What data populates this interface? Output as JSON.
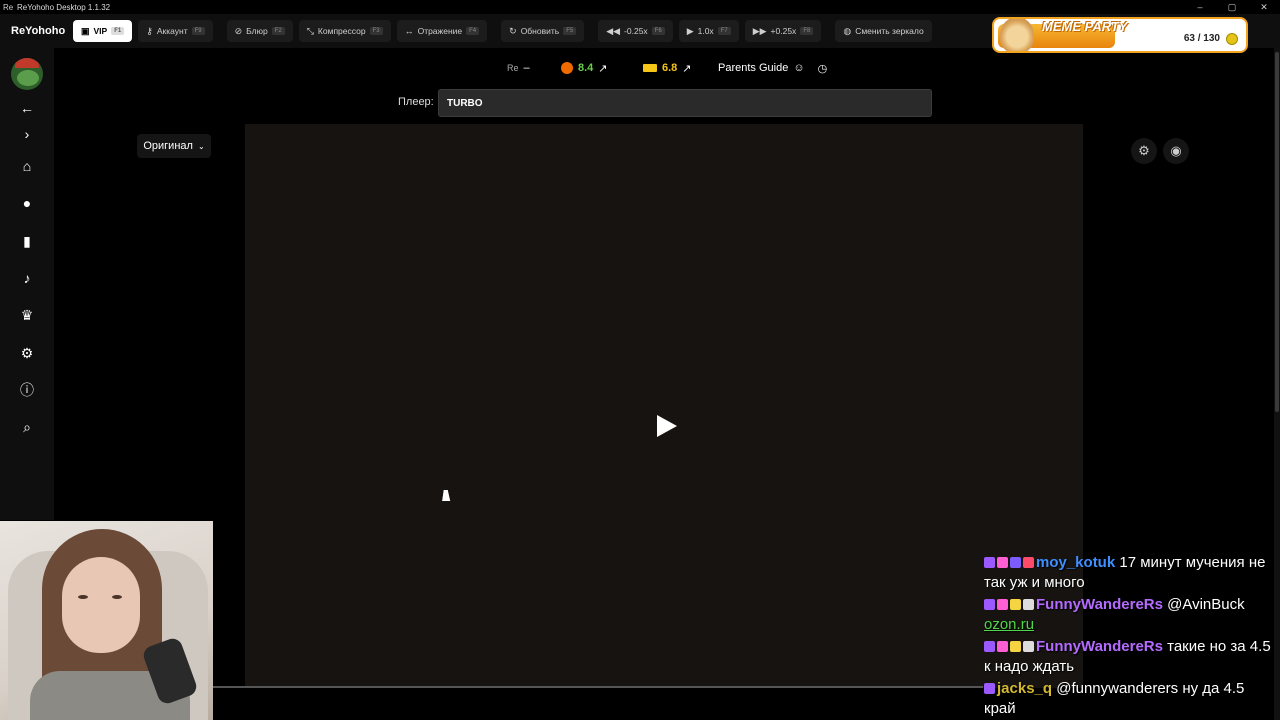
{
  "window": {
    "app_icon": "Re",
    "title": "ReYohoho Desktop 1.1.32",
    "controls": [
      "–",
      "▢",
      "✕"
    ]
  },
  "toolbar": {
    "brand": "ReYohoho",
    "buttons": [
      {
        "label": "VIP",
        "key": "F1",
        "icon": "window-icon"
      },
      {
        "label": "Аккаунт",
        "key": "F9",
        "icon": "key-icon"
      },
      {
        "label": "Блюр",
        "key": "F2",
        "icon": "eye-slash-icon"
      },
      {
        "label": "Компрессор",
        "key": "F3",
        "icon": "compress-icon"
      },
      {
        "label": "Отражение",
        "key": "F4",
        "icon": "mirror-icon"
      },
      {
        "label": "Обновить",
        "key": "F5",
        "icon": "refresh-icon"
      },
      {
        "label": "-0.25x",
        "key": "F6",
        "icon": "rewind-icon"
      },
      {
        "label": "1.0x",
        "key": "F7",
        "icon": "play-icon"
      },
      {
        "label": "+0.25x",
        "key": "F8",
        "icon": "forward-icon"
      },
      {
        "label": "Сменить зеркало",
        "key": "",
        "icon": "globe-icon"
      }
    ]
  },
  "overlay": {
    "title": "MEME PARTY",
    "count": "63 / 130",
    "progress": 0.48
  },
  "info": {
    "re_label": "Re",
    "re_value": "–",
    "kp_rating": "8.4",
    "imdb_rating": "6.8",
    "parents_guide": "Parents Guide"
  },
  "player": {
    "label": "Плеер:",
    "value": "TURBO"
  },
  "original_button": "Оригинал",
  "chat": [
    {
      "user": "moy_kotuk",
      "color": "#3f8fff",
      "text": " 17 минут мучения не так уж и много",
      "badges": [
        "#9b59ff",
        "#ff5fd2",
        "#7d5cff",
        "#ff4a6a"
      ]
    },
    {
      "user": "FunnyWandereRs",
      "color": "#b46bff",
      "text": " @AvinBuck",
      "link": "ozon.ru",
      "badges": [
        "#9b59ff",
        "#ff5fd2",
        "#f5d442",
        "#ddd"
      ]
    },
    {
      "user": "FunnyWandereRs",
      "color": "#b46bff",
      "text": " такие но за 4.5 к надо ждать",
      "badges": [
        "#9b59ff",
        "#ff5fd2",
        "#f5d442",
        "#ddd"
      ]
    },
    {
      "user": "jacks_q",
      "color": "#d4b830",
      "text": " @funnywanderers ну да 4.5 край",
      "badges": [
        "#9b59ff"
      ]
    }
  ]
}
